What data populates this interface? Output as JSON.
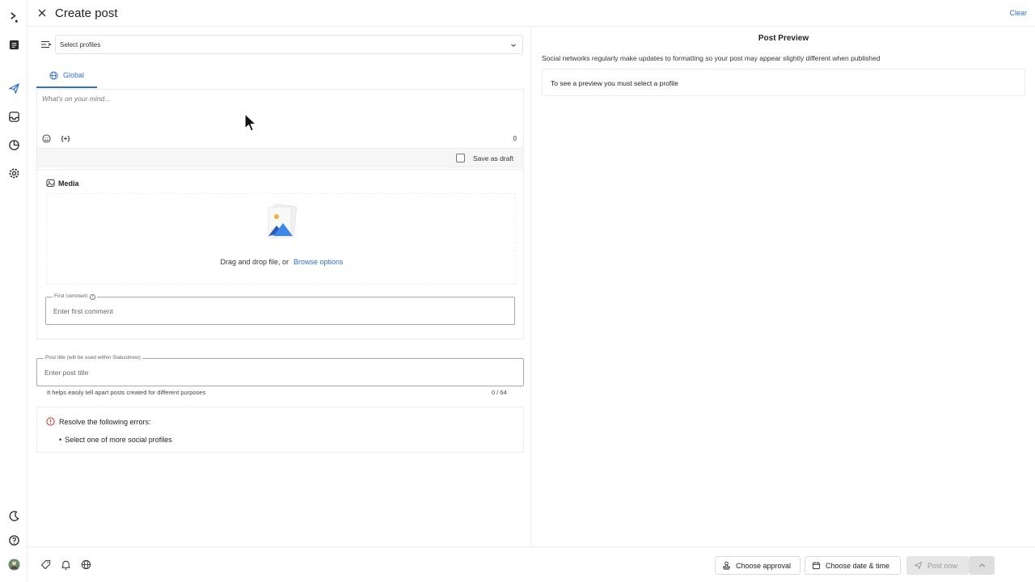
{
  "header": {
    "title": "Create post",
    "clear_label": "Clear"
  },
  "composer": {
    "profiles_placeholder": "Select profiles",
    "tab_label": "Global",
    "message_placeholder": "What's on your mind...",
    "char_count": "0",
    "variable_icon_text": "{+}",
    "save_draft_label": "Save as draft",
    "media_label": "Media",
    "drop_text": "Drag and drop file, or",
    "browse_label": "Browse options",
    "first_comment_label": "First comment",
    "first_comment_placeholder": "Enter first comment",
    "post_title_label": "Post title (will be used within Statusbrew)",
    "post_title_placeholder": "Enter post title",
    "post_title_hint": "It helps easily tell apart posts created for different purposes",
    "post_title_count": "0 / 64",
    "errors_title": "Resolve the following errors:",
    "errors": [
      "Select one of more social profiles"
    ]
  },
  "preview": {
    "title": "Post Preview",
    "note": "Social networks regularly make updates to formatting so your post may appear slightly different when published",
    "empty_message": "To see a preview you must select a profile"
  },
  "footer": {
    "approval_label": "Choose approval",
    "date_label": "Choose date & time",
    "post_label": "Post now"
  },
  "colors": {
    "accent": "#2f6fcf",
    "error": "#d9342b",
    "disabled_bg": "#e6e6e6"
  },
  "icons": {
    "rail": [
      "statusbrew-logo-icon",
      "notes-icon",
      "publish-icon",
      "inbox-icon",
      "reports-icon",
      "settings-icon",
      "dark-mode-icon",
      "help-icon",
      "avatar"
    ],
    "footer": [
      "tag-icon",
      "bell-icon",
      "globe-icon"
    ]
  }
}
